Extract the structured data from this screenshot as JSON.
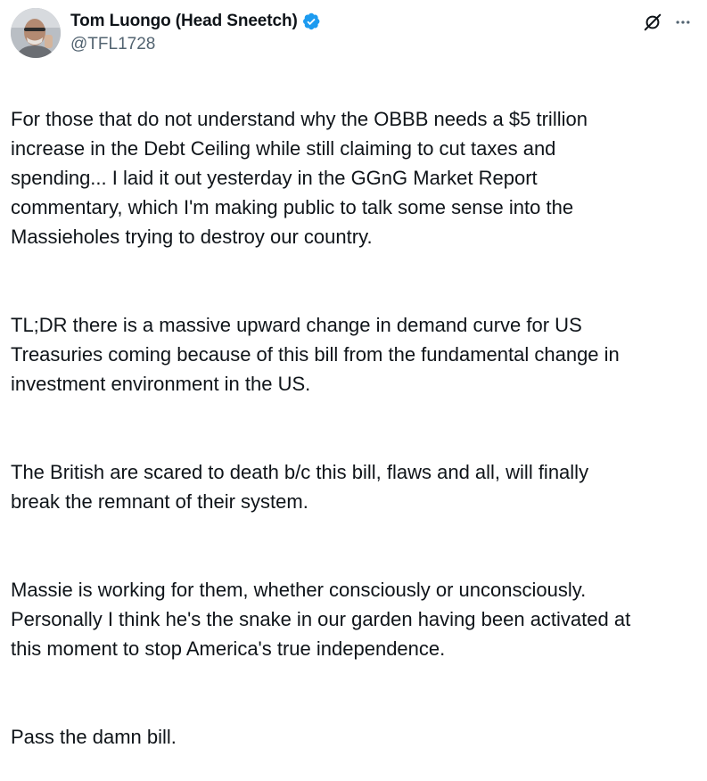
{
  "author": {
    "display_name": "Tom Luongo (Head Sneetch)",
    "handle": "@TFL1728",
    "avatar_icon": "user-avatar-photo",
    "verified_icon": "verified-badge-icon",
    "verified_color": "#1d9bf0"
  },
  "actions": {
    "grok_icon": "grok-icon",
    "more_icon": "more-options-icon"
  },
  "tweet": {
    "paragraphs": [
      "For those that do not understand why the OBBB needs a $5 trillion\nincrease in the Debt Ceiling while still claiming to cut taxes and\nspending... I laid it out yesterday in the GGnG Market Report\ncommentary, which I'm making public to talk some sense into the\nMassieholes trying to destroy our country.",
      "TL;DR there is a massive upward change in demand curve for US\nTreasuries coming because of this bill from the fundamental change in\ninvestment environment in the US.",
      "The British are scared to death b/c this bill, flaws and all, will finally\nbreak the remnant of their system.",
      "Massie is working for them, whether consciously or unconsciously.\nPersonally I think he's the snake in our garden having been activated at\nthis moment to stop America's true independence.",
      "Pass the damn bill."
    ]
  }
}
